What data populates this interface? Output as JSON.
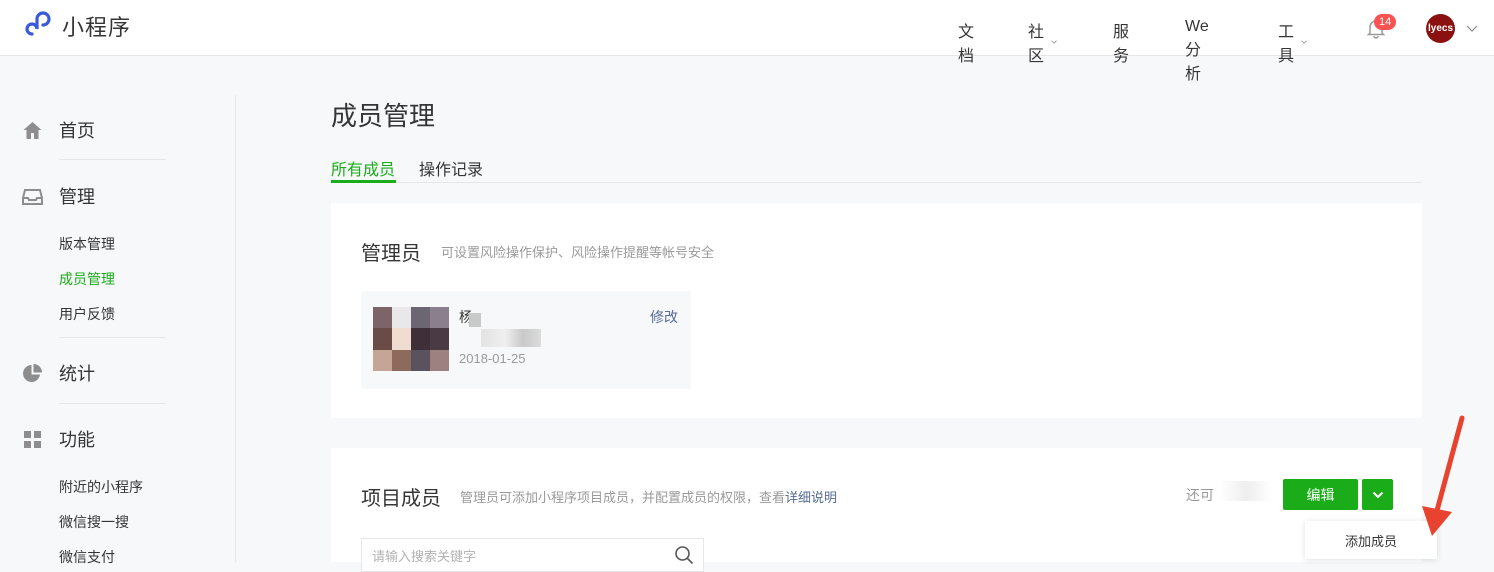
{
  "app": {
    "title": "小程序"
  },
  "nav": {
    "items": [
      {
        "label": "文档",
        "dropdown": false
      },
      {
        "label": "社区",
        "dropdown": true
      },
      {
        "label": "服务",
        "dropdown": false
      },
      {
        "label": "We分析",
        "dropdown": false
      },
      {
        "label": "工具",
        "dropdown": true
      }
    ],
    "notifications": "14",
    "avatar_text": "lyecs"
  },
  "sidebar": {
    "home": "首页",
    "manage": "管理",
    "manage_items": [
      "版本管理",
      "成员管理",
      "用户反馈"
    ],
    "stats": "统计",
    "features": "功能",
    "feature_items": [
      "附近的小程序",
      "微信搜一搜",
      "微信支付"
    ]
  },
  "page": {
    "title": "成员管理",
    "tabs": [
      "所有成员",
      "操作记录"
    ],
    "admin": {
      "title": "管理员",
      "desc": "可设置风险操作保护、风险操作提醒等帐号安全",
      "member_name": "杨",
      "member_date": "2018-01-25",
      "edit_label": "修改"
    },
    "project": {
      "title": "项目成员",
      "desc": "管理员可添加小程序项目成员，并配置成员的权限，查看",
      "desc_link": "详细说明",
      "quota_prefix": "还可",
      "edit_button": "编辑",
      "search_placeholder": "请输入搜索关键字",
      "dropdown_item": "添加成员"
    }
  },
  "colors": {
    "accent": "#1aad19",
    "link": "#576b95",
    "badge": "#fa5151",
    "annotation_arrow": "#e8432e"
  }
}
